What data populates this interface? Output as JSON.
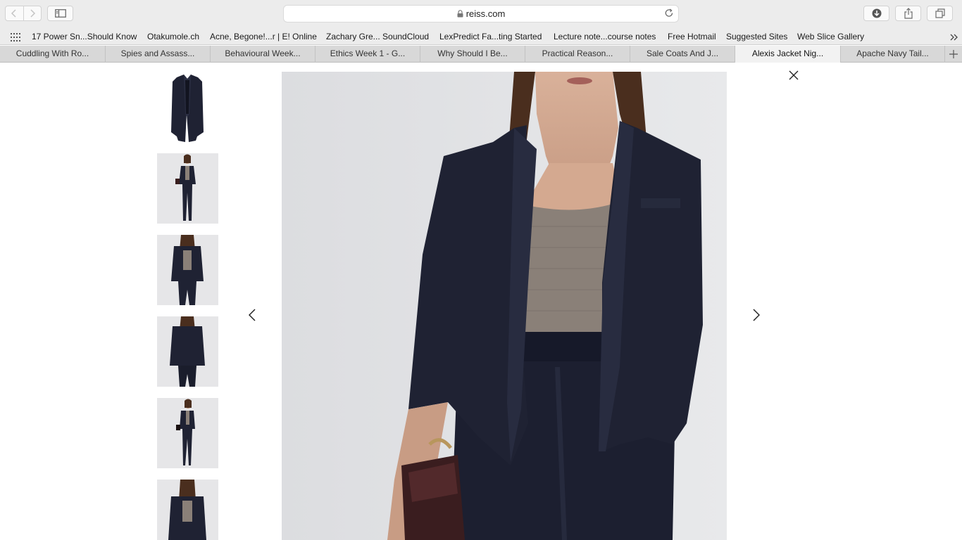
{
  "browser": {
    "address": "reiss.com",
    "bookmarks": [
      "17 Power Sn...Should Know",
      "Otakumole.ch",
      "Acne, Begone!...r | E! Online",
      "Zachary Gre... SoundCloud",
      "LexPredict Fa...ting Started",
      "Lecture note...course notes",
      "Free Hotmail",
      "Suggested Sites",
      "Web Slice Gallery"
    ],
    "tabs": [
      "Cuddling With Ro...",
      "Spies and Assass...",
      "Behavioural Week...",
      "Ethics Week 1 - G...",
      "Why Should I Be...",
      "Practical Reason...",
      "Sale Coats And J...",
      "Alexis Jacket Nig...",
      "Apache Navy Tail..."
    ],
    "active_tab_index": 7,
    "icons": {
      "back": "back-arrow-icon",
      "forward": "forward-arrow-icon",
      "sidebar": "sidebar-icon",
      "lock": "lock-icon",
      "reload": "reload-icon",
      "download": "download-icon",
      "share": "share-icon",
      "tabs": "tab-overview-icon",
      "apps": "apps-grid-icon",
      "overflow": "chevron-double-right-icon",
      "new_tab": "plus-icon"
    }
  },
  "gallery": {
    "thumbnails": [
      "jacket-flat",
      "full-front",
      "half-front",
      "back-view",
      "full-side",
      "crop-front"
    ],
    "selected_thumbnail": 2,
    "colors": {
      "navy": "#1f2233",
      "backdrop": "#e4e5e7",
      "knit": "#8a8078"
    },
    "icons": {
      "prev": "chevron-left-icon",
      "next": "chevron-right-icon",
      "close": "close-icon"
    }
  }
}
